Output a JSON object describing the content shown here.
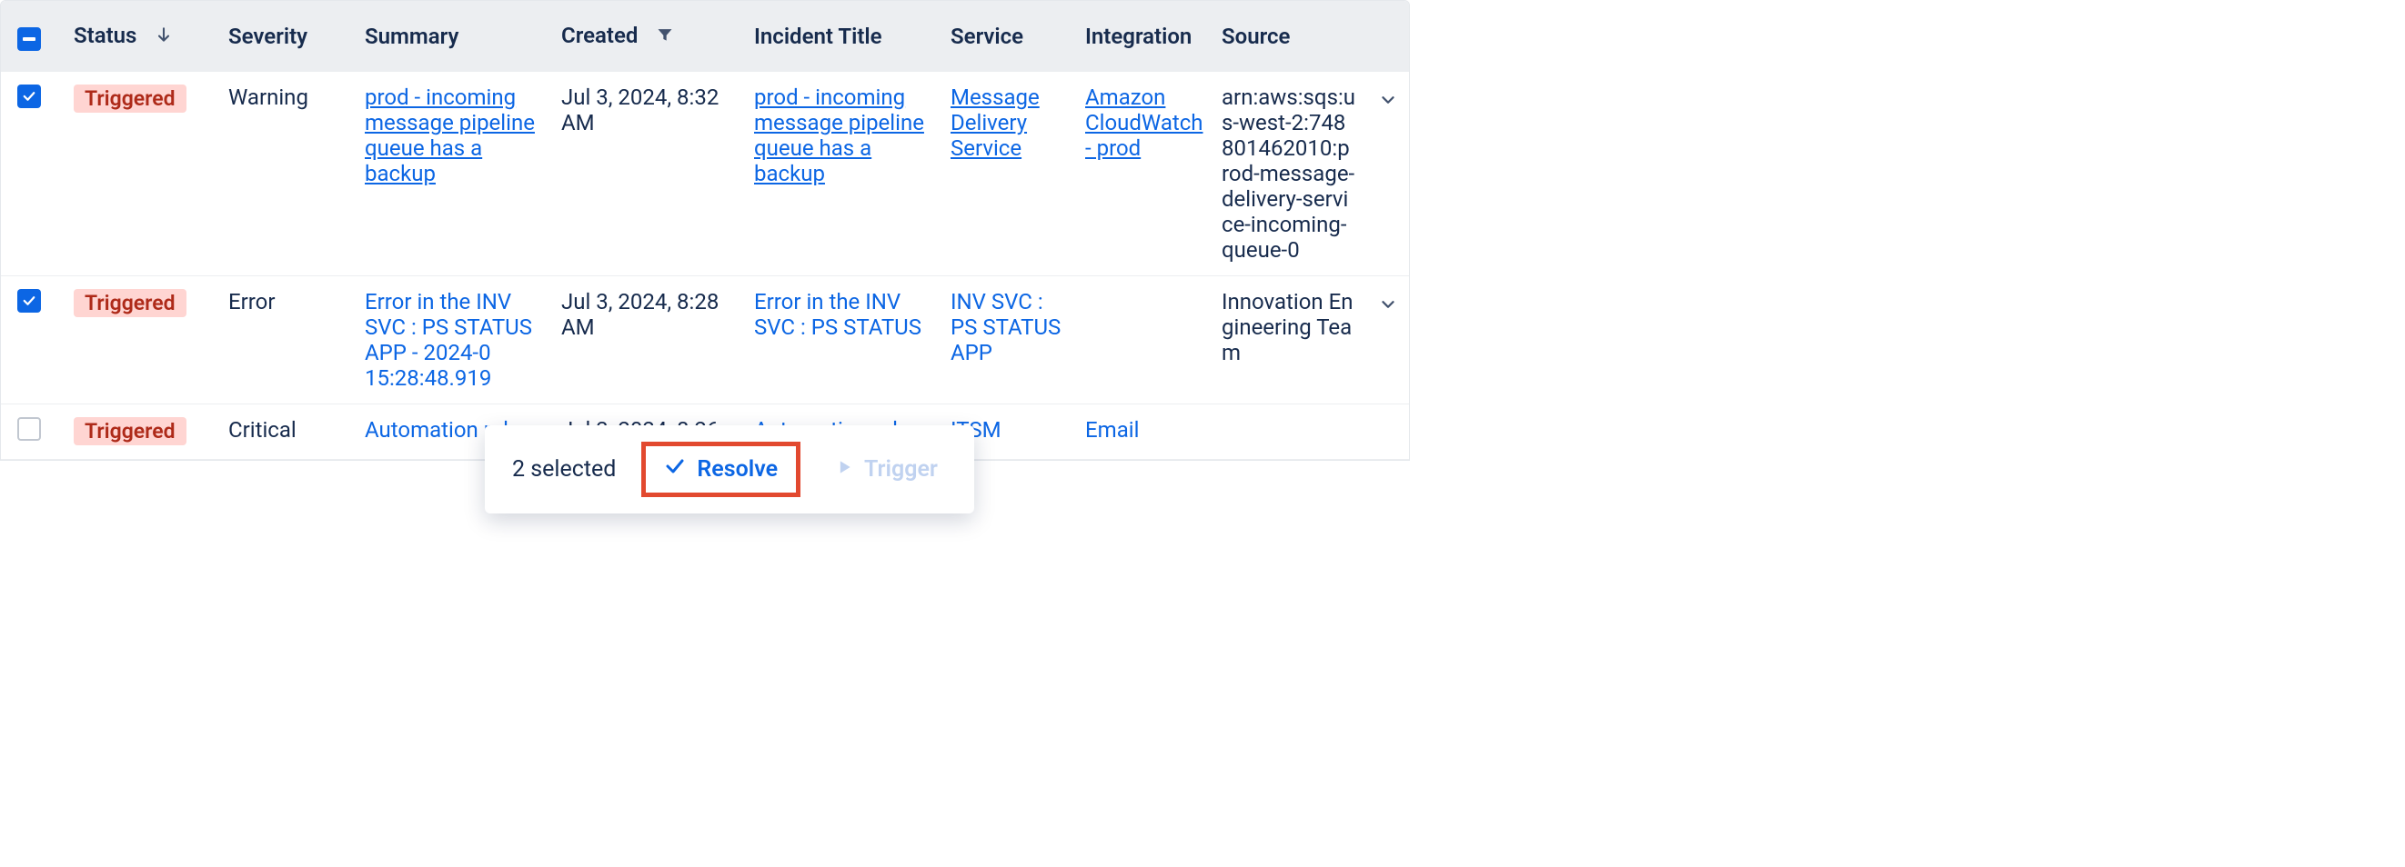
{
  "columns": {
    "status": "Status",
    "severity": "Severity",
    "summary": "Summary",
    "created": "Created",
    "incident_title": "Incident Title",
    "service": "Service",
    "integration": "Integration",
    "source": "Source"
  },
  "rows": [
    {
      "checked": true,
      "status": "Triggered",
      "severity": "Warning",
      "summary": "prod - incoming message pipeline queue has a backup",
      "summary_underline": true,
      "created": "Jul 3, 2024, 8:32 AM",
      "incident_title": "prod - incoming message pipeline queue has a backup",
      "incident_underline": true,
      "service": "Message Delivery Service",
      "service_underline": true,
      "integration": "Amazon CloudWatch - prod",
      "integration_underline": true,
      "source": "arn:aws:sqs:us-west-2:748801462010:prod-message-delivery-service-incoming-queue-0",
      "expand": true
    },
    {
      "checked": true,
      "status": "Triggered",
      "severity": "Error",
      "summary": "Error in the INV SVC : PS STATUS APP - 2024-0  15:28:48.919",
      "summary_underline": false,
      "created": "Jul 3, 2024, 8:28 AM",
      "incident_title": "Error in the INV SVC : PS STATUS",
      "incident_underline": false,
      "service": "INV SVC : PS STATUS APP",
      "service_underline": false,
      "integration": "",
      "integration_underline": false,
      "source": "Innovation Engineering Team",
      "expand": true
    },
    {
      "checked": false,
      "status": "Triggered",
      "severity": "Critical",
      "summary": "Automation rule",
      "summary_underline": false,
      "created": "Jul 3, 2024, 8:26",
      "incident_title": "Automation rule",
      "incident_underline": false,
      "service": "ITSM",
      "service_underline": false,
      "integration": "Email",
      "integration_underline": false,
      "source": "",
      "expand": false
    }
  ],
  "action_bar": {
    "selected_text": "2 selected",
    "resolve": "Resolve",
    "trigger": "Trigger"
  }
}
